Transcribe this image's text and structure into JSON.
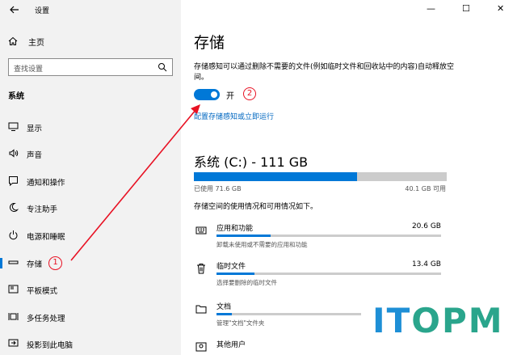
{
  "window": {
    "title": "设置",
    "minimize": "—",
    "maximize": "☐",
    "close": "✕"
  },
  "sidebar": {
    "home_label": "主页",
    "search_placeholder": "查找设置",
    "section_label": "系统",
    "items": [
      {
        "label": "显示",
        "icon": "display-icon"
      },
      {
        "label": "声音",
        "icon": "sound-icon"
      },
      {
        "label": "通知和操作",
        "icon": "notification-icon"
      },
      {
        "label": "专注助手",
        "icon": "moon-icon"
      },
      {
        "label": "电源和睡眠",
        "icon": "power-icon"
      },
      {
        "label": "存储",
        "icon": "storage-icon",
        "active": true
      },
      {
        "label": "平板模式",
        "icon": "tablet-icon"
      },
      {
        "label": "多任务处理",
        "icon": "multitask-icon"
      },
      {
        "label": "投影到此电脑",
        "icon": "project-icon"
      }
    ],
    "annotation_1": "1"
  },
  "main": {
    "title": "存储",
    "description": "存储感知可以通过删除不需要的文件(例如临时文件和回收站中的内容)自动释放空间。",
    "toggle_label": "开",
    "toggle_on": true,
    "annotation_2": "2",
    "config_link": "配置存储感知或立即运行",
    "drive_title": "系统 (C:) - 111 GB",
    "used_label": "已使用 71.6 GB",
    "free_label": "40.1 GB 可用",
    "used_fraction": 0.645,
    "usage_info": "存储空间的使用情况和可用情况如下。",
    "categories": [
      {
        "name": "应用和功能",
        "size": "20.6 GB",
        "sub": "卸载未使用或不需要的应用和功能",
        "fraction": 0.24,
        "icon": "apps-icon"
      },
      {
        "name": "临时文件",
        "size": "13.4 GB",
        "sub": "选择要删除的临时文件",
        "fraction": 0.17,
        "icon": "trash-icon"
      },
      {
        "name": "文档",
        "size": "",
        "sub": "管理\"文档\"文件夹",
        "fraction": 0.07,
        "icon": "folder-icon"
      },
      {
        "name": "其他用户",
        "size": "",
        "sub": "",
        "fraction": 0,
        "icon": "users-icon"
      }
    ]
  },
  "watermark": {
    "part1": "IT",
    "part2": "OPM"
  },
  "colors": {
    "accent": "#0078d7",
    "annotation": "#e81123",
    "sidebar_bg": "#f2f2f2"
  }
}
